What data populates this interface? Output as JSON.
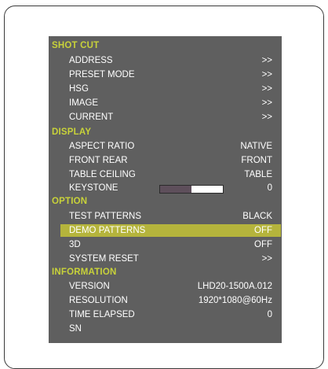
{
  "colors": {
    "section_header": "#c8d23a",
    "highlight": "#b5b43c",
    "panel": "#5f5f5f",
    "slider_fill": "#5e4f5b"
  },
  "sections": [
    {
      "title": "SHOT CUT",
      "items": [
        {
          "label": "ADDRESS",
          "value": ">>"
        },
        {
          "label": "PRESET MODE",
          "value": ">>"
        },
        {
          "label": "HSG",
          "value": ">>"
        },
        {
          "label": "IMAGE",
          "value": ">>"
        },
        {
          "label": "CURRENT",
          "value": ">>"
        }
      ]
    },
    {
      "title": "DISPLAY",
      "items": [
        {
          "label": "ASPECT RATIO",
          "value": "NATIVE"
        },
        {
          "label": "FRONT REAR",
          "value": "FRONT"
        },
        {
          "label": "TABLE CEILING",
          "value": "TABLE"
        },
        {
          "label": "KEYSTONE",
          "value": "0",
          "slider_fraction": 0.5
        }
      ]
    },
    {
      "title": "OPTION",
      "items": [
        {
          "label": "TEST PATTERNS",
          "value": "BLACK"
        },
        {
          "label": "DEMO PATTERNS",
          "value": "OFF",
          "selected": true
        },
        {
          "label": "3D",
          "value": "OFF"
        },
        {
          "label": "SYSTEM RESET",
          "value": ">>"
        }
      ]
    },
    {
      "title": "INFORMATION",
      "items": [
        {
          "label": "VERSION",
          "value": "LHD20-1500A.012"
        },
        {
          "label": "RESOLUTION",
          "value": "1920*1080@60Hz"
        },
        {
          "label": "TIME ELAPSED",
          "value": "0"
        },
        {
          "label": "SN",
          "value": ""
        }
      ]
    }
  ]
}
